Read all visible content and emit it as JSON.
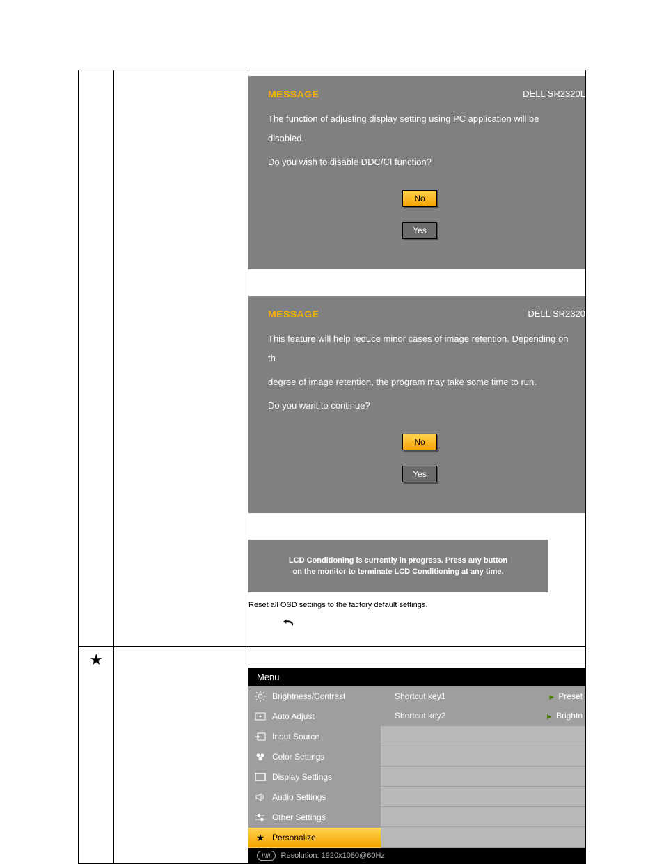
{
  "dialog1": {
    "title": "MESSAGE",
    "model": "DELL  SR2320L",
    "line1": "The function of adjusting display setting using PC application will be disabled.",
    "line2": "Do you wish to disable DDC/CI function?",
    "no": "No",
    "yes": "Yes"
  },
  "dialog2": {
    "title": "MESSAGE",
    "model": "DELL  SR2320",
    "line1": "This feature will help reduce minor cases of image retention. Depending on th",
    "line2": "degree of image retention, the program may take some time to run.",
    "line3": "Do you want to continue?",
    "no": "No",
    "yes": "Yes"
  },
  "conditioningBox": {
    "line1": "LCD Conditioning is currently in progress. Press any button",
    "line2": "on the monitor to terminate LCD Conditioning at any time."
  },
  "resetText": "Reset all OSD settings to the factory default settings.",
  "osd": {
    "menuLabel": "Menu",
    "headerRight": "",
    "items": [
      {
        "label": "Brightness/Contrast"
      },
      {
        "label": "Auto Adjust"
      },
      {
        "label": "Input Source"
      },
      {
        "label": "Color Settings"
      },
      {
        "label": "Display Settings"
      },
      {
        "label": "Audio Settings"
      },
      {
        "label": "Other Settings"
      },
      {
        "label": "Personalize"
      }
    ],
    "shortcuts": [
      {
        "label": "Shortcut key1",
        "value": "Preset"
      },
      {
        "label": "Shortcut key2",
        "value": "Brightn"
      }
    ],
    "resolutionLabel": "Resolution:  1920x1080@60Hz"
  }
}
